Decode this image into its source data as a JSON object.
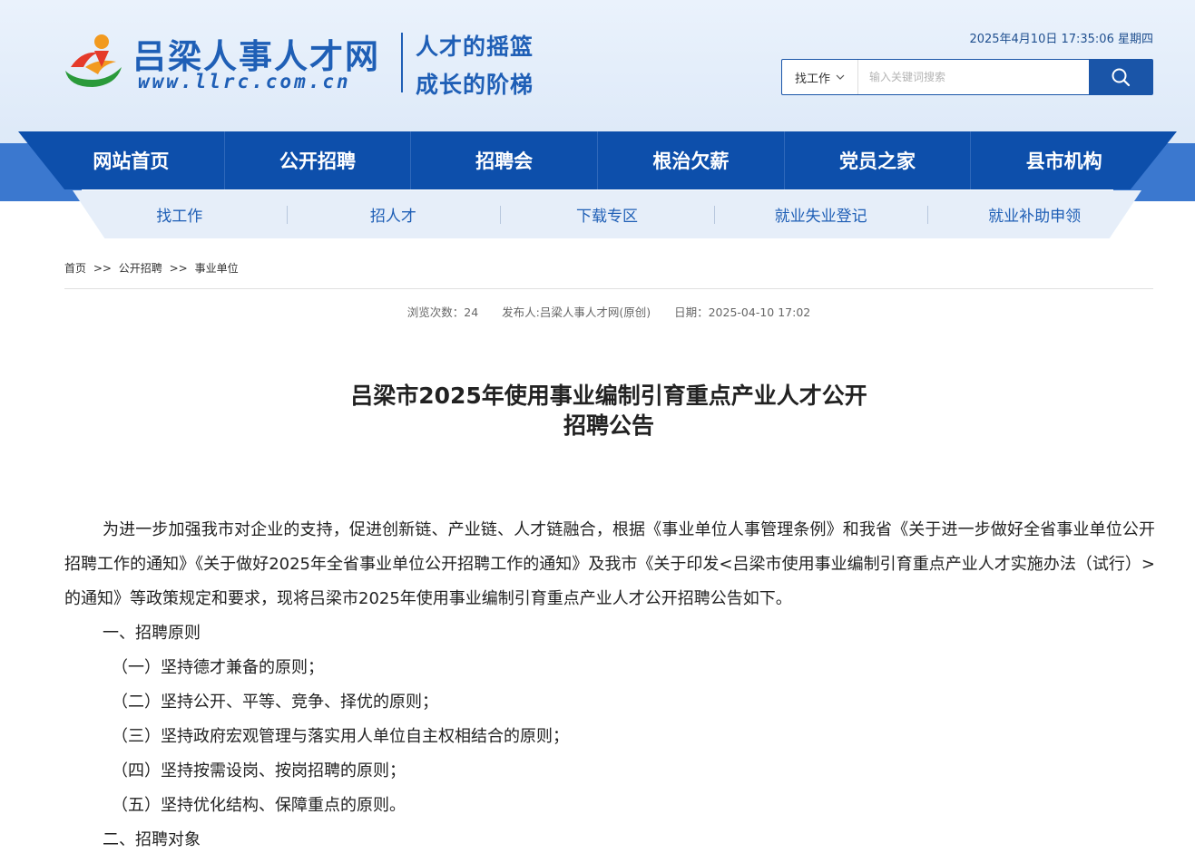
{
  "header": {
    "logo_name": "吕梁人事人才网",
    "logo_url": "www.llrc.com.cn",
    "slogan_line1": "人才的摇篮",
    "slogan_line2": "成长的阶梯",
    "datetime": "2025年4月10日 17:35:06 星期四",
    "search": {
      "category": "找工作",
      "placeholder": "输入关键词搜索",
      "button_icon": "search-icon"
    },
    "brand_color": "#1f5fb6"
  },
  "main_nav": {
    "items": [
      "网站首页",
      "公开招聘",
      "招聘会",
      "根治欠薪",
      "党员之家",
      "县市机构"
    ],
    "color": "#0d4fab"
  },
  "sub_nav": {
    "items": [
      "找工作",
      "招人才",
      "下载专区",
      "就业失业登记",
      "就业补助申领"
    ]
  },
  "breadcrumb": {
    "items": [
      "首页",
      "公开招聘",
      "事业单位"
    ],
    "separator": ">>"
  },
  "meta": {
    "views": "浏览次数：24",
    "publisher": "发布人:吕梁人事人才网(原创)",
    "date": "日期：2025-04-10 17:02"
  },
  "article": {
    "title_line1": "吕梁市2025年使用事业编制引育重点产业人才公开",
    "title_line2": "招聘公告",
    "intro": "为进一步加强我市对企业的支持，促进创新链、产业链、人才链融合，根据《事业单位人事管理条例》和我省《关于进一步做好全省事业单位公开招聘工作的通知》《关于做好2025年全省事业单位公开招聘工作的通知》及我市《关于印发<吕梁市使用事业编制引育重点产业人才实施办法（试行）>的通知》等政策规定和要求，现将吕梁市2025年使用事业编制引育重点产业人才公开招聘公告如下。",
    "section1": "一、招聘原则",
    "principles": [
      "（一）坚持德才兼备的原则；",
      "（二）坚持公开、平等、竞争、择优的原则；",
      "（三）坚持政府宏观管理与落实用人单位自主权相结合的原则；",
      "（四）坚持按需设岗、按岗招聘的原则；",
      "（五）坚持优化结构、保障重点的原则。"
    ],
    "section2": "二、招聘对象"
  }
}
